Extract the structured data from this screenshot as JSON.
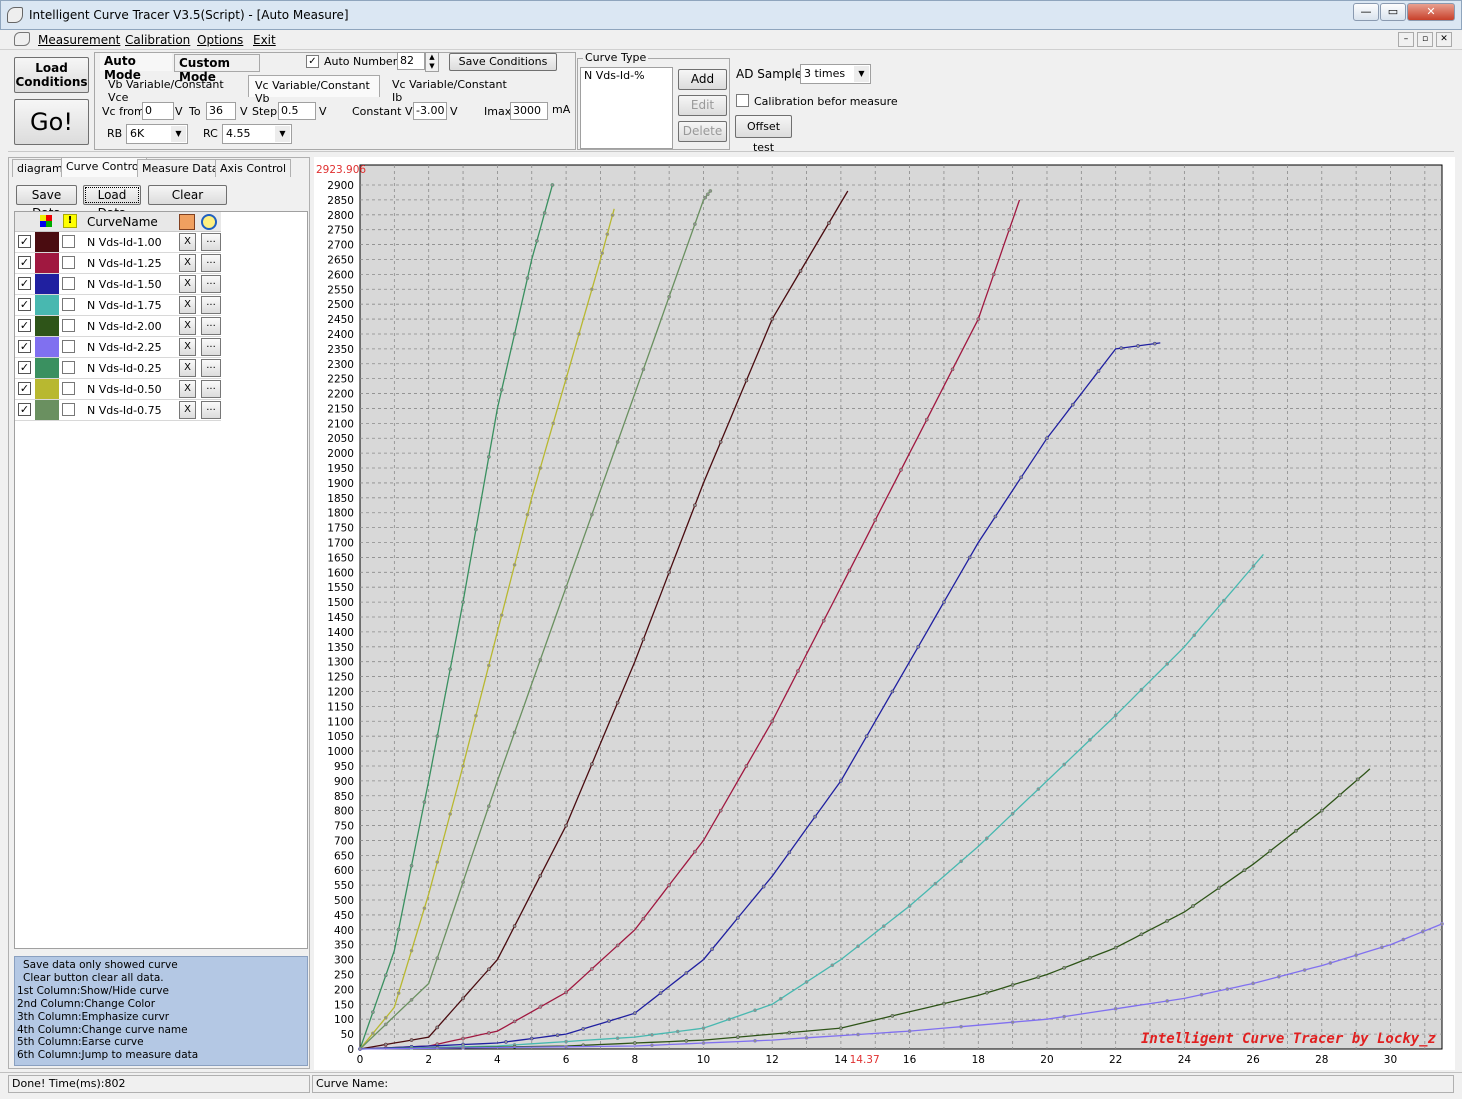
{
  "window": {
    "title": "Intelligent Curve Tracer V3.5(Script) - [Auto Measure]"
  },
  "menu": [
    "Measurement",
    "Calibration",
    "Options",
    "Exit"
  ],
  "toolbar": {
    "load_label": "Load Conditions",
    "go_label": "Go!",
    "mode_tabs": [
      "Auto Mode",
      "Custom Mode"
    ],
    "auto_number_label": "Auto Number",
    "auto_number_value": "82",
    "save_conditions": "Save Conditions",
    "sub_tabs": [
      "Vb Variable/Constant Vce",
      "Vc Variable/Constant Vb",
      "Vc Variable/Constant Ib"
    ],
    "vc_from_label": "Vc from",
    "vc_from": "0",
    "v1": "V",
    "to_label": "To",
    "to_value": "36",
    "v2": "V",
    "step_label": "Step",
    "step_value": "0.5",
    "v3": "V",
    "constant_vb_label": "Constant Vb",
    "constant_vb": "-3.00",
    "v4": "V",
    "imax_label": "Imax",
    "imax_value": "3000",
    "ma": "mA",
    "rb_label": "RB",
    "rb_value": "6K",
    "rc_label": "RC",
    "rc_value": "4.55"
  },
  "curve_type": {
    "label": "Curve Type",
    "item": "N Vds-Id-%",
    "add": "Add",
    "edit": "Edit",
    "delete": "Delete"
  },
  "ad": {
    "label": "AD Sample",
    "value": "3 times",
    "calib_label": "Calibration befor measure",
    "offset": "Offset test"
  },
  "left_tabs": [
    "diagram",
    "Curve Control",
    "Measure Data",
    "Axis Control"
  ],
  "left_buttons": {
    "save": "Save Data",
    "load": "Load Data",
    "clear": "Clear"
  },
  "curve_table": {
    "header": "CurveName",
    "rows": [
      {
        "name": "N Vds-Id-1.00",
        "color": "#4a0c10"
      },
      {
        "name": "N Vds-Id-1.25",
        "color": "#a01840"
      },
      {
        "name": "N Vds-Id-1.50",
        "color": "#2020a0"
      },
      {
        "name": "N Vds-Id-1.75",
        "color": "#48b8b0"
      },
      {
        "name": "N Vds-Id-2.00",
        "color": "#2e5418"
      },
      {
        "name": "N Vds-Id-2.25",
        "color": "#8070f0"
      },
      {
        "name": "N Vds-Id-0.25",
        "color": "#3a9060"
      },
      {
        "name": "N Vds-Id-0.50",
        "color": "#b8b830"
      },
      {
        "name": "N Vds-Id-0.75",
        "color": "#6a9060"
      }
    ],
    "x_label": "X",
    "dots_label": "..."
  },
  "help_lines": [
    "Save data only showed curve",
    "Clear button clear all data.",
    "1st Column:Show/Hide curve",
    "2nd Column:Change Color",
    "3th Column:Emphasize curvr",
    "4th Column:Change curve name",
    "5th Column:Earse curve",
    "6th Column:Jump to measure data"
  ],
  "status": {
    "left": "Done!  Time(ms):802",
    "right": "Curve Name:"
  },
  "chart_data": {
    "type": "line",
    "xlim": [
      0,
      31.5
    ],
    "ylim": [
      0,
      2900
    ],
    "x_ticks": [
      0,
      2,
      4,
      6,
      8,
      10,
      12,
      14,
      16,
      18,
      20,
      22,
      24,
      26,
      28,
      30
    ],
    "y_tick_step": 50,
    "max_label": "2923.906",
    "cursor_x_label": "14.37",
    "watermark": "Intelligent Curve Tracer by Locky_z",
    "grid": true,
    "series": [
      {
        "name": "N Vds-Id-0.25",
        "color": "#3a9060",
        "x": [
          0,
          1,
          2,
          3,
          4,
          5,
          5.6
        ],
        "y": [
          0,
          330,
          900,
          1500,
          2150,
          2650,
          2900
        ]
      },
      {
        "name": "N Vds-Id-0.50",
        "color": "#b8b830",
        "x": [
          0,
          1,
          2,
          3,
          4,
          5,
          6,
          7,
          7.4
        ],
        "y": [
          0,
          140,
          520,
          950,
          1400,
          1850,
          2250,
          2650,
          2820
        ]
      },
      {
        "name": "N Vds-Id-0.75",
        "color": "#6a9060",
        "x": [
          0,
          2,
          4,
          6,
          8,
          10,
          10.2
        ],
        "y": [
          0,
          220,
          900,
          1550,
          2200,
          2850,
          2880
        ]
      },
      {
        "name": "N Vds-Id-1.00",
        "color": "#4a0c10",
        "x": [
          0,
          2,
          4,
          6,
          8,
          10,
          12,
          14.2
        ],
        "y": [
          0,
          40,
          300,
          750,
          1300,
          1900,
          2450,
          2880
        ]
      },
      {
        "name": "N Vds-Id-1.25",
        "color": "#a01840",
        "x": [
          0,
          2,
          4,
          6,
          8,
          10,
          12,
          14,
          16,
          18,
          19.2
        ],
        "y": [
          0,
          10,
          60,
          190,
          400,
          700,
          1100,
          1550,
          2000,
          2450,
          2850
        ]
      },
      {
        "name": "N Vds-Id-1.50",
        "color": "#2020a0",
        "x": [
          0,
          4,
          6,
          8,
          10,
          12,
          14,
          16,
          18,
          20,
          22,
          23.3
        ],
        "y": [
          0,
          20,
          50,
          120,
          300,
          580,
          900,
          1300,
          1700,
          2050,
          2350,
          2370
        ]
      },
      {
        "name": "N Vds-Id-1.75",
        "color": "#48b8b0",
        "x": [
          0,
          4,
          8,
          10,
          12,
          14,
          16,
          18,
          20,
          22,
          24,
          26.3
        ],
        "y": [
          0,
          10,
          40,
          70,
          150,
          300,
          480,
          680,
          900,
          1120,
          1350,
          1660
        ]
      },
      {
        "name": "N Vds-Id-2.00",
        "color": "#2e5418",
        "x": [
          0,
          6,
          10,
          14,
          18,
          20,
          22,
          24,
          26,
          28,
          29.4
        ],
        "y": [
          0,
          10,
          30,
          70,
          180,
          250,
          340,
          460,
          620,
          800,
          940
        ]
      },
      {
        "name": "N Vds-Id-2.25",
        "color": "#8070f0",
        "x": [
          0,
          8,
          12,
          16,
          20,
          24,
          26,
          28,
          30,
          31.5
        ],
        "y": [
          0,
          10,
          30,
          60,
          100,
          170,
          220,
          280,
          350,
          420
        ]
      }
    ]
  }
}
